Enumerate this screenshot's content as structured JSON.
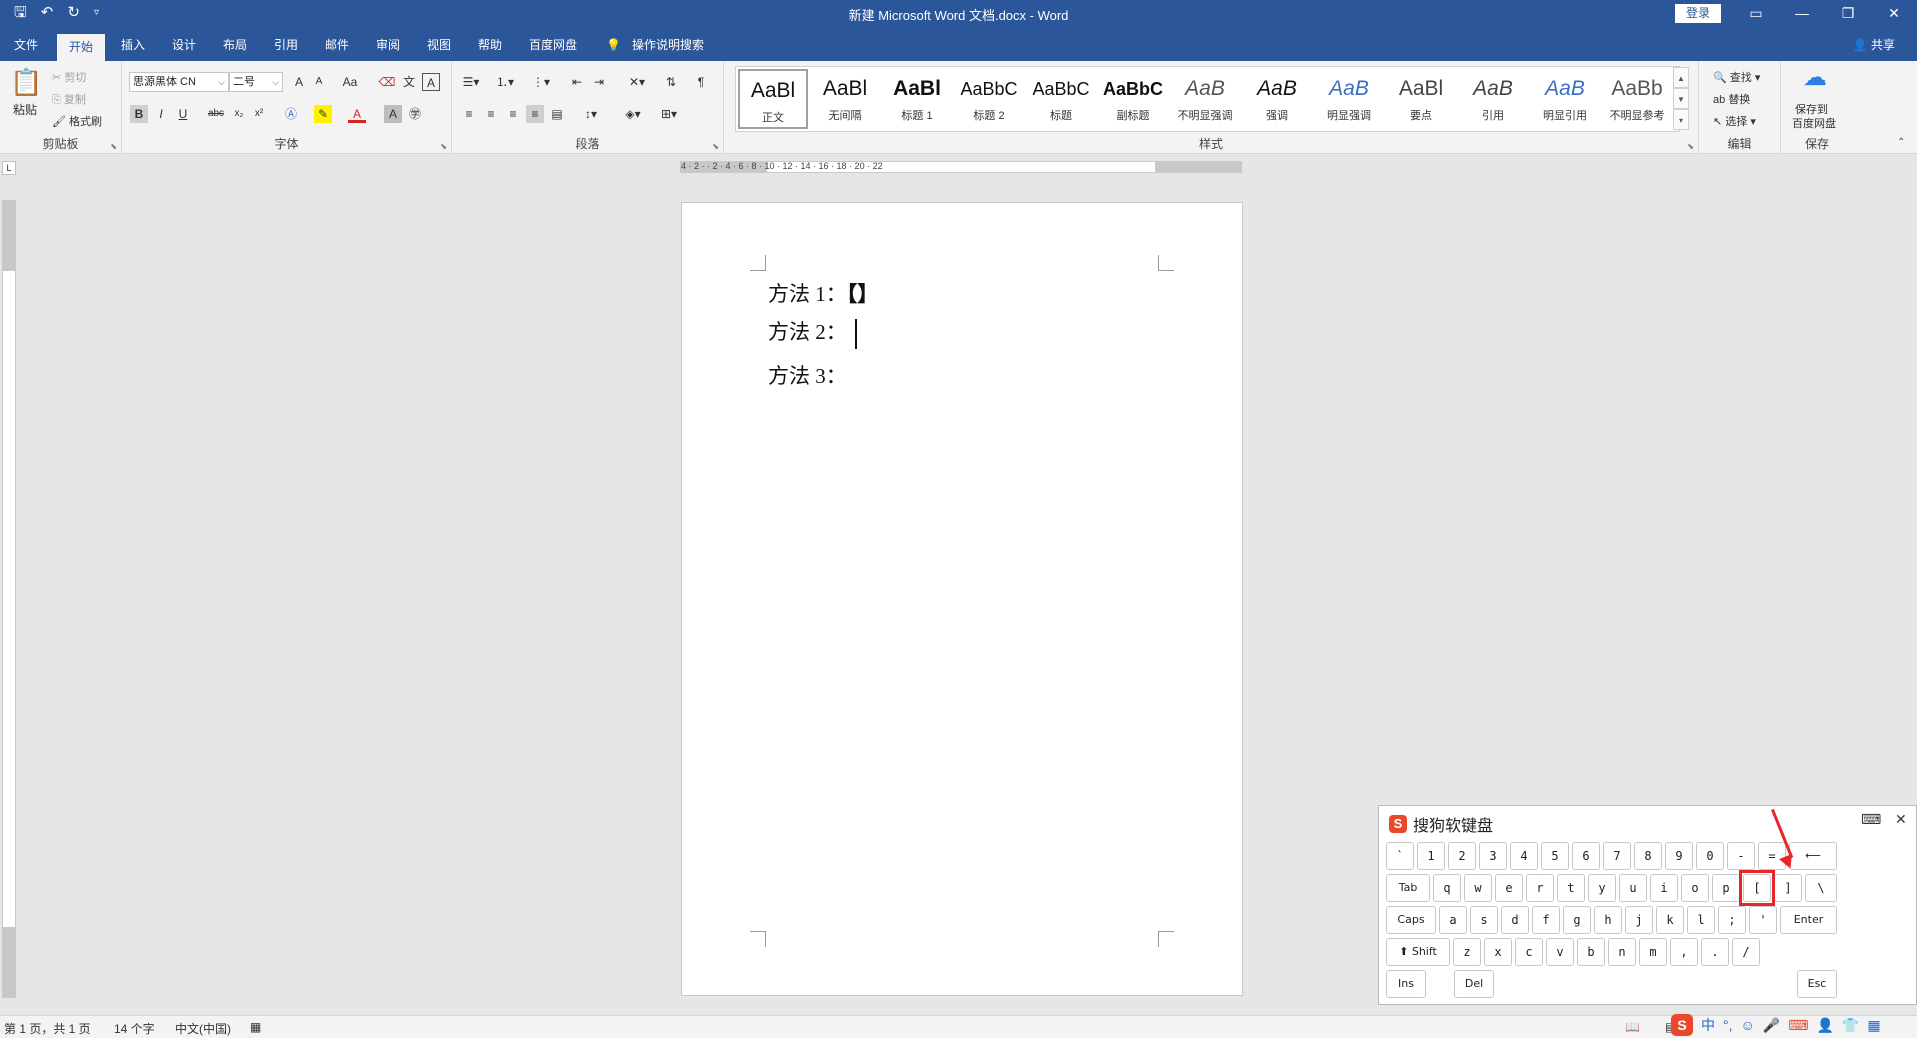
{
  "titlebar": {
    "title": "新建 Microsoft Word 文档.docx  -  Word",
    "login": "登录",
    "qat_icons": [
      "save-icon",
      "undo-icon",
      "redo-icon",
      "customize-icon"
    ]
  },
  "tabs": [
    {
      "label": "文件"
    },
    {
      "label": "开始"
    },
    {
      "label": "插入"
    },
    {
      "label": "设计"
    },
    {
      "label": "布局"
    },
    {
      "label": "引用"
    },
    {
      "label": "邮件"
    },
    {
      "label": "审阅"
    },
    {
      "label": "视图"
    },
    {
      "label": "帮助"
    },
    {
      "label": "百度网盘"
    },
    {
      "label": "操作说明搜索"
    }
  ],
  "share": "共享",
  "clipboard": {
    "paste": "粘贴",
    "cut": "剪切",
    "copy": "复制",
    "format_painter": "格式刷",
    "label": "剪贴板"
  },
  "font": {
    "family": "思源黑体 CN",
    "size": "二号",
    "label": "字体",
    "grow": "A",
    "shrink": "A",
    "case": "Aa",
    "bold": "B",
    "italic": "I",
    "underline": "U",
    "strike": "abc",
    "sub": "x₂",
    "sup": "x²"
  },
  "paragraph": {
    "label": "段落"
  },
  "styles": {
    "label": "样式",
    "items": [
      {
        "sample": "AaBl",
        "name": "正文"
      },
      {
        "sample": "AaBl",
        "name": "无间隔"
      },
      {
        "sample": "AaBl",
        "name": "标题 1"
      },
      {
        "sample": "AaBbC",
        "name": "标题 2"
      },
      {
        "sample": "AaBbC",
        "name": "标题"
      },
      {
        "sample": "AaBbC",
        "name": "副标题"
      },
      {
        "sample": "AaB",
        "name": "不明显强调"
      },
      {
        "sample": "AaB",
        "name": "强调"
      },
      {
        "sample": "AaB",
        "name": "明显强调"
      },
      {
        "sample": "AaBl",
        "name": "要点"
      },
      {
        "sample": "AaB",
        "name": "引用"
      },
      {
        "sample": "AaB",
        "name": "明显引用"
      },
      {
        "sample": "AaBb",
        "name": "不明显参考"
      }
    ]
  },
  "editing": {
    "find": "查找",
    "replace": "替换",
    "select": "选择",
    "label": "编辑"
  },
  "save_group": {
    "button": "保存到\n百度网盘",
    "line1": "保存到",
    "line2": "百度网盘",
    "label": "保存"
  },
  "ruler": {
    "h_numbers": "4 · 2 ·   · 2 · 4 · 6 · 8 · 10 · 12 · 14 · 16 · 18 · 20 · 22"
  },
  "document": {
    "lines": [
      {
        "text": "方法 1：",
        "bracket": "【】"
      },
      {
        "text": "方法 2："
      },
      {
        "text": "方法 3："
      }
    ]
  },
  "status": {
    "page": "第 1 页，共 1 页",
    "words": "14 个字",
    "language": "中文(中国)"
  },
  "soft_keyboard": {
    "title": "搜狗软键盘",
    "row1": [
      "`",
      "1",
      "2",
      "3",
      "4",
      "5",
      "6",
      "7",
      "8",
      "9",
      "0",
      "-",
      "=",
      "⟵"
    ],
    "row2": [
      "Tab",
      "q",
      "w",
      "e",
      "r",
      "t",
      "y",
      "u",
      "i",
      "o",
      "p",
      "[",
      "]",
      "\\"
    ],
    "row3": [
      "Caps",
      "a",
      "s",
      "d",
      "f",
      "g",
      "h",
      "j",
      "k",
      "l",
      ";",
      "'",
      "Enter"
    ],
    "row4": [
      "⬆ Shift",
      "z",
      "x",
      "c",
      "v",
      "b",
      "n",
      "m",
      ",",
      ".",
      "/"
    ],
    "row5": [
      "Ins",
      "Del",
      "Esc"
    ],
    "highlight_color": "#e8262a"
  },
  "tray": {
    "ime_mode": "中",
    "punct": "°,"
  },
  "colors": {
    "brand": "#2b579a",
    "accent_red": "#e8262a",
    "sogou": "#e8492b"
  }
}
